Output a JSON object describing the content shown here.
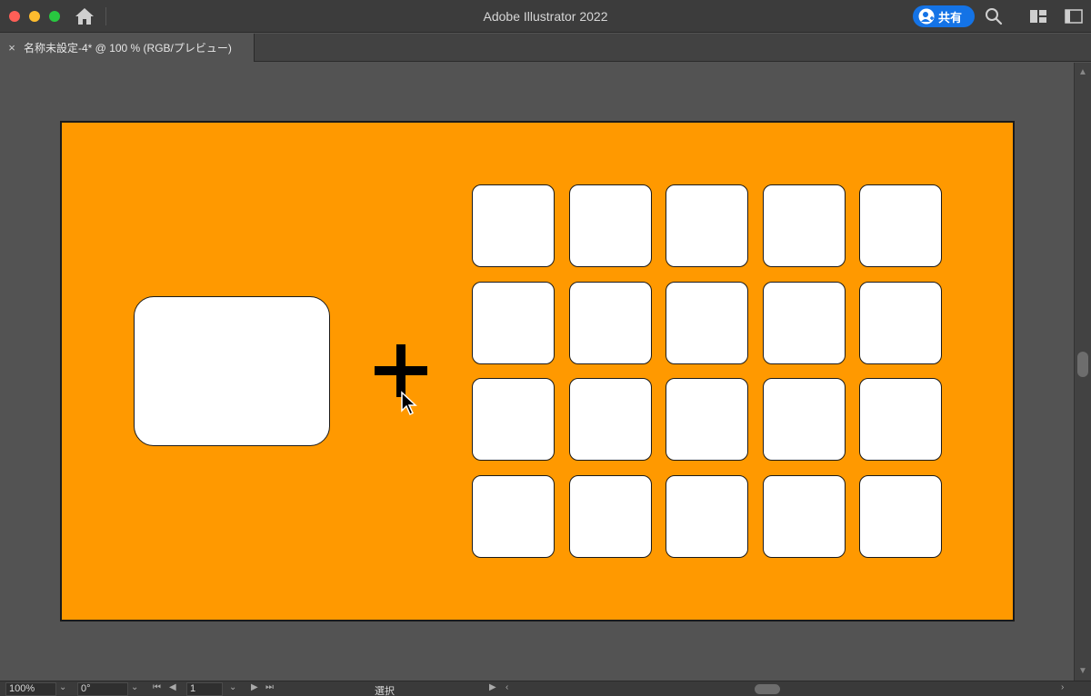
{
  "app": {
    "title": "Adobe Illustrator 2022",
    "share_label": "共有"
  },
  "tab": {
    "close_label": "×",
    "label": "名称未設定-4* @ 100 % (RGB/プレビュー)"
  },
  "artboard": {
    "background_color": "#ff9900",
    "grid_rows": 4,
    "grid_cols": 5
  },
  "statusbar": {
    "zoom": "100%",
    "rotation": "0°",
    "artboard_number": "1",
    "current_tool": "選択"
  },
  "icons": {
    "home": "home-icon",
    "search": "search-icon",
    "plus": "plus-icon",
    "cursor": "cursor-icon"
  }
}
